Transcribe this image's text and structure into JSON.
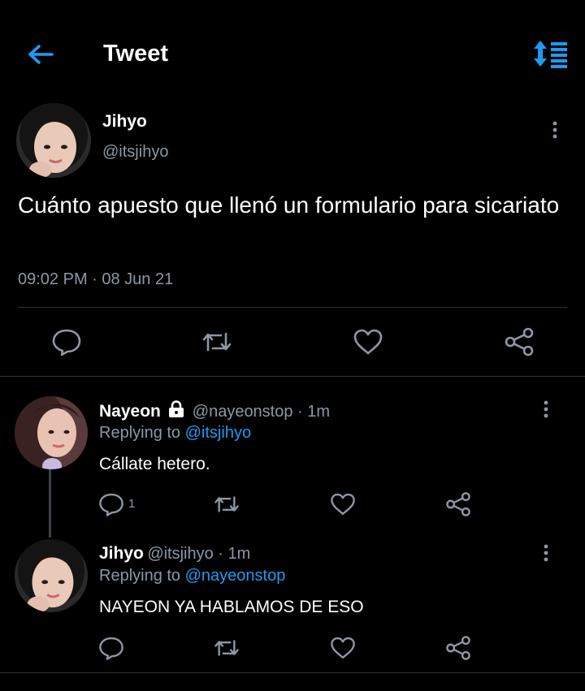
{
  "header": {
    "title": "Tweet"
  },
  "tweet": {
    "author_name": "Jihyo",
    "author_handle": "@itsjihyo",
    "text": "Cuánto apuesto que llenó un formulario para sicariato",
    "meta": "09:02 PM · 08 Jun 21"
  },
  "replies": [
    {
      "author_name": "Nayeon",
      "handle_time": "@nayeonstop · 1m",
      "replying_prefix": "Replying to",
      "replying_to": "@itsjihyo",
      "text": "Cállate hetero.",
      "reply_count": "1"
    },
    {
      "author_name": "Jihyo",
      "handle_time": "@itsjihyo · 1m",
      "replying_prefix": "Replying to",
      "replying_to": "@nayeonstop",
      "text": "NAYEON YA HABLAMOS DE ESO"
    }
  ],
  "colors": {
    "accent": "#1d9bf0",
    "background": "#000000",
    "muted": "#8b98a5"
  },
  "icons": [
    "back-arrow-icon",
    "sort-icon",
    "more-vertical-icon",
    "reply-icon",
    "retweet-icon",
    "like-icon",
    "share-icon",
    "lock-icon"
  ]
}
